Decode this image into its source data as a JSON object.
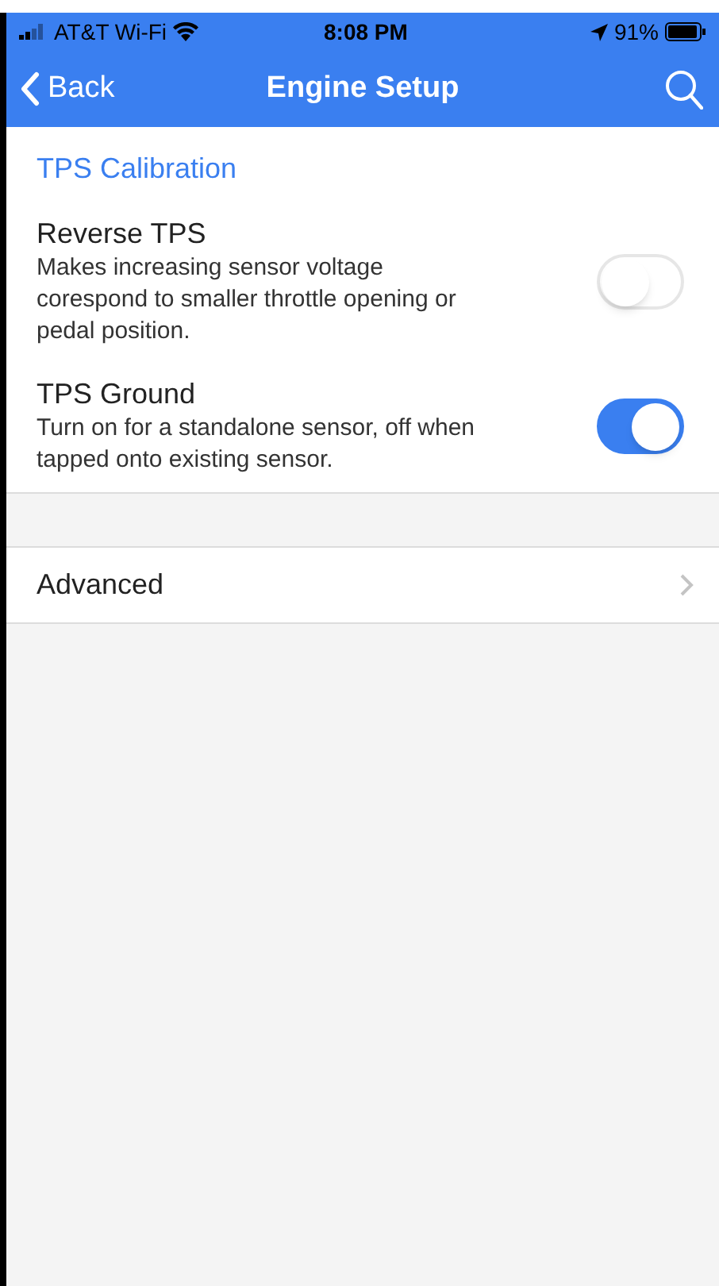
{
  "status_bar": {
    "carrier": "AT&T Wi-Fi",
    "time": "8:08 PM",
    "battery": "91%"
  },
  "nav_bar": {
    "back": "Back",
    "title": "Engine Setup"
  },
  "section": {
    "title": "TPS Calibration",
    "settings": [
      {
        "label": "Reverse TPS",
        "description": "Makes increasing sensor voltage corespond to smaller throttle opening or pedal position.",
        "on": false
      },
      {
        "label": "TPS Ground",
        "description": "Turn on for a standalone sensor, off when tapped onto existing sensor.",
        "on": true
      }
    ]
  },
  "links": [
    {
      "label": "Advanced"
    }
  ]
}
